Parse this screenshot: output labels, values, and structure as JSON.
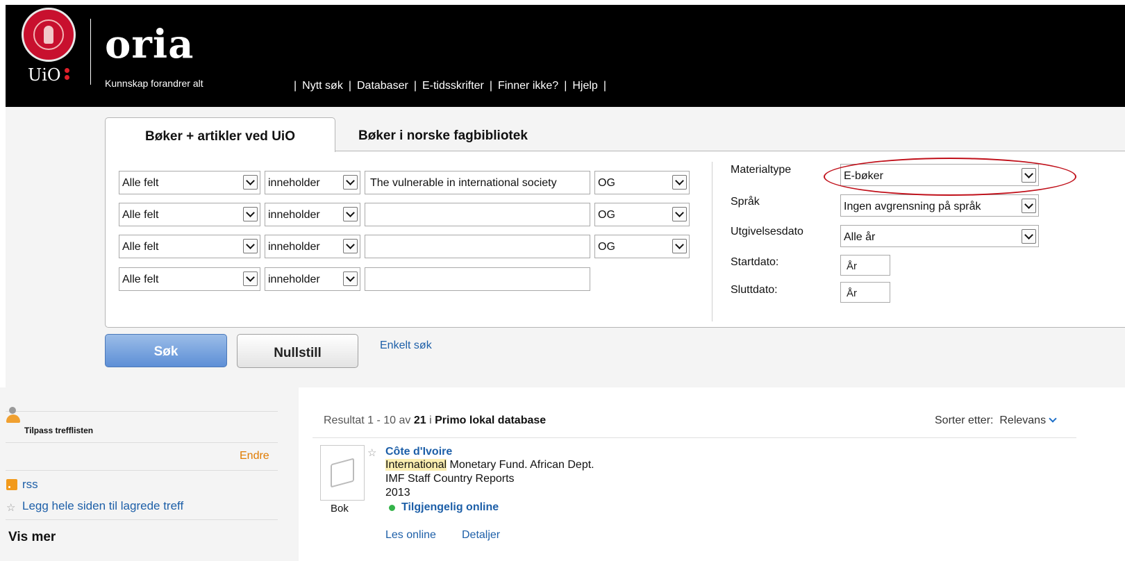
{
  "header": {
    "brand": "oria",
    "logo_text": "UiO",
    "tagline": "Kunnskap forandrer alt",
    "nav": [
      "Nytt søk",
      "Databaser",
      "E-tidsskrifter",
      "Finner ikke?",
      "Hjelp"
    ],
    "separator": "|"
  },
  "tabs": {
    "active": "Bøker + artikler ved UiO",
    "inactive": "Bøker i norske fagbibliotek"
  },
  "search_rows": [
    {
      "field": "Alle felt",
      "operator": "inneholder",
      "value": "The vulnerable in international society",
      "bool": "OG"
    },
    {
      "field": "Alle felt",
      "operator": "inneholder",
      "value": "",
      "bool": "OG"
    },
    {
      "field": "Alle felt",
      "operator": "inneholder",
      "value": "",
      "bool": "OG"
    },
    {
      "field": "Alle felt",
      "operator": "inneholder",
      "value": ""
    }
  ],
  "filters": {
    "materialtype_label": "Materialtype",
    "materialtype_value": "E-bøker",
    "sprak_label": "Språk",
    "sprak_value": "Ingen avgrensning på språk",
    "utgivelsesdato_label": "Utgivelsesdato",
    "utgivelsesdato_value": "Alle år",
    "startdato_label": "Startdato:",
    "startdato_placeholder": "År",
    "sluttdato_label": "Sluttdato:",
    "sluttdato_placeholder": "År"
  },
  "buttons": {
    "search": "Søk",
    "reset": "Nullstill",
    "simple_search": "Enkelt søk"
  },
  "sidebar": {
    "customize": "Tilpass trefflisten",
    "change": "Endre",
    "rss": "rss",
    "save_page": "Legg hele siden til lagrede treff",
    "show_more": "Vis mer"
  },
  "results": {
    "prefix": "Resultat 1 - 10 av ",
    "total": "21",
    "in_label": " i ",
    "database": "Primo lokal database",
    "sort_label": "Sorter etter:",
    "sort_value": "Relevans",
    "items": [
      {
        "title": "Côte d'Ivoire",
        "author_highlight": "International",
        "author_rest": " Monetary Fund. African Dept.",
        "series": "IMF Staff Country Reports",
        "year": "2013",
        "availability": "Tilgjengelig online",
        "type": "Bok",
        "link_read": "Les online",
        "link_details": "Detaljer"
      }
    ]
  },
  "colors": {
    "header_bg": "#000000",
    "link": "#1d5fa8",
    "accent_orange": "#e07b00",
    "search_button": "#5d8fd6",
    "highlight_oval": "#c0101a",
    "available": "#34b34a"
  }
}
